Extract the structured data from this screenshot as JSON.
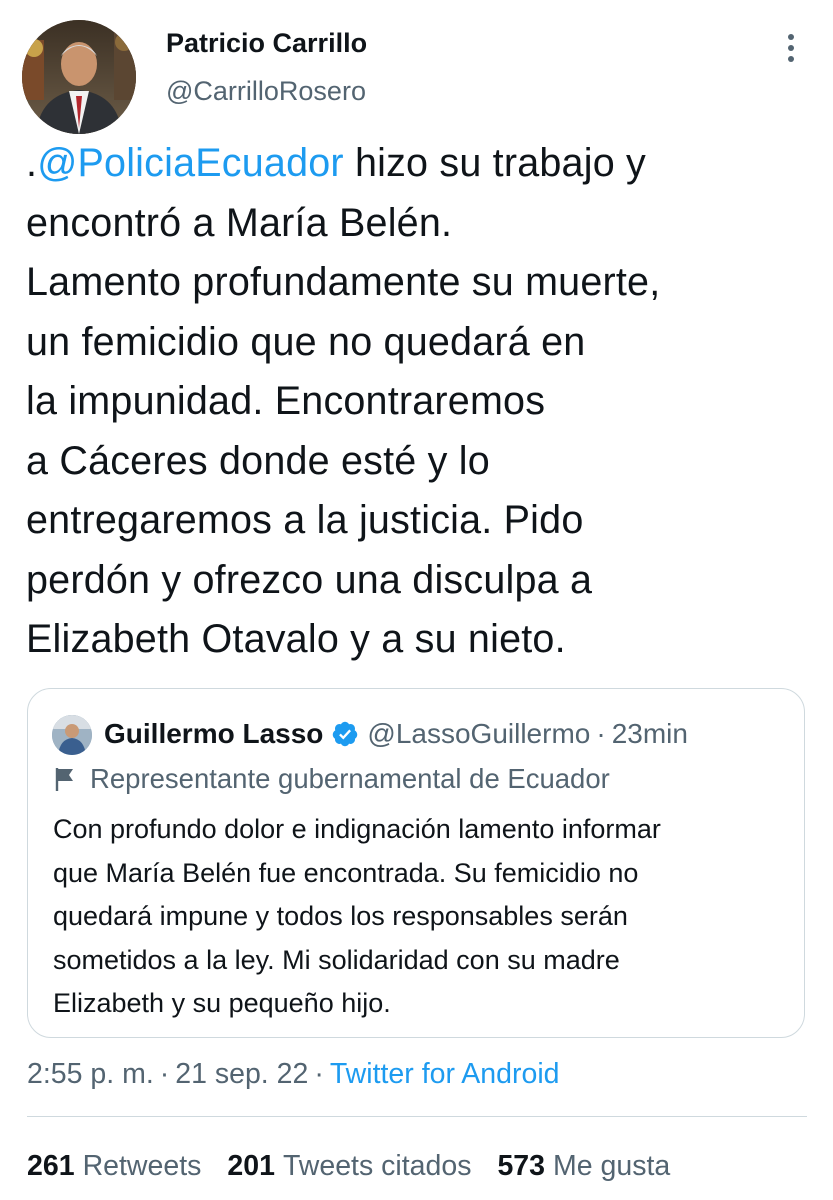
{
  "author": {
    "name": "Patricio Carrillo",
    "handle": "@CarrilloRosero"
  },
  "tweet": {
    "lines": [
      {
        "prefix": ".",
        "mention": "@PoliciaEcuador",
        "text": " hizo su trabajo y"
      },
      {
        "text": "encontró a María Belén."
      },
      {
        "text": "Lamento profundamente su muerte,"
      },
      {
        "text": "un femicidio que no quedará en"
      },
      {
        "text": "la impunidad. Encontraremos"
      },
      {
        "text": "a Cáceres donde esté y lo"
      },
      {
        "text": "entregaremos a la justicia. Pido"
      },
      {
        "text": "perdón y ofrezco una disculpa a"
      },
      {
        "text": "Elizabeth Otavalo y a su nieto."
      }
    ]
  },
  "quote": {
    "name": "Guillermo Lasso",
    "verified_icon": "verified-badge-icon",
    "handle": "@LassoGuillermo",
    "dot": "·",
    "time": "23min",
    "label_icon": "flag-icon",
    "label": "Representante gubernamental de Ecuador",
    "lines": [
      "Con profundo dolor e indignación lamento informar",
      "que María Belén fue encontrada. Su femicidio no",
      "quedará impune y todos los responsables serán",
      "sometidos a la ley. Mi solidaridad con su madre",
      "Elizabeth y su pequeño hijo."
    ]
  },
  "meta": {
    "time": "2:55 p. m.",
    "sep": "·",
    "date": "21 sep. 22",
    "source": "Twitter for Android"
  },
  "stats": {
    "retweets_count": "261",
    "retweets_label": "Retweets",
    "quotes_count": "201",
    "quotes_label": "Tweets citados",
    "likes_count": "573",
    "likes_label": "Me gusta"
  },
  "colors": {
    "accent": "#1d9bf0",
    "secondary_text": "#536471",
    "border": "#cfd9de",
    "verified": "#1d9bf0"
  },
  "icons": {
    "more": "more-vertical-icon"
  }
}
